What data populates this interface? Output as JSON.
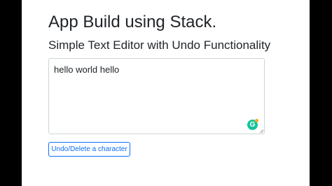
{
  "page": {
    "title": "App Build using Stack.",
    "subtitle": "Simple Text Editor with Undo Functionality"
  },
  "editor": {
    "value": "hello world hello",
    "grammarly_icon": "grammarly-icon",
    "grammarly_letter": "G"
  },
  "actions": {
    "undo_label": "Undo/Delete a character"
  },
  "colors": {
    "accent": "#0d6efd",
    "grammarly": "#15c39a",
    "letterbox": "#000000"
  }
}
